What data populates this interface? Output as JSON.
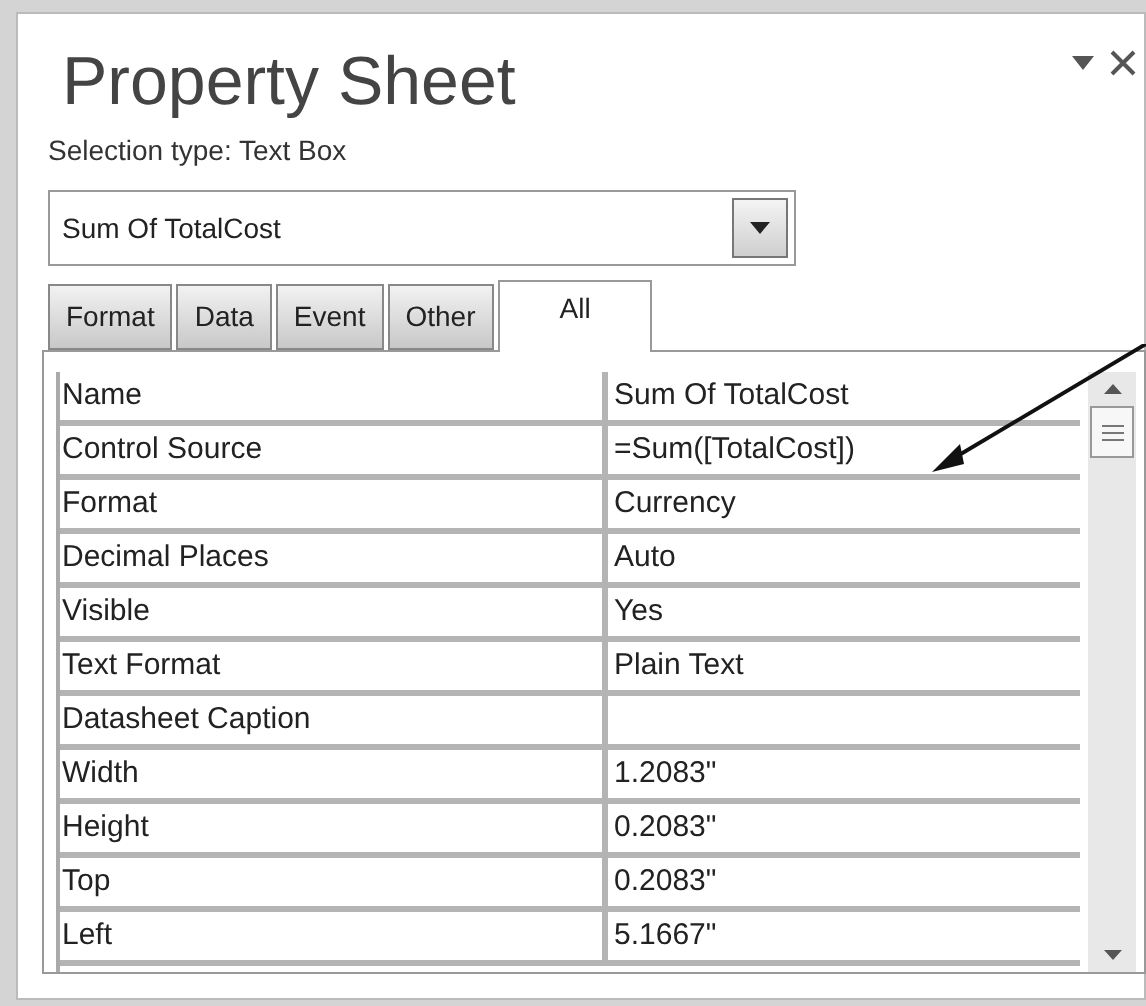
{
  "panel": {
    "title": "Property Sheet",
    "selection_type": "Selection type:  Text Box",
    "selector": {
      "value": "Sum Of TotalCost"
    }
  },
  "tabs": [
    {
      "label": "Format",
      "selected": false
    },
    {
      "label": "Data",
      "selected": false
    },
    {
      "label": "Event",
      "selected": false
    },
    {
      "label": "Other",
      "selected": false
    },
    {
      "label": "All",
      "selected": true
    }
  ],
  "properties": [
    {
      "name": "Name",
      "value": "Sum Of TotalCost"
    },
    {
      "name": "Control Source",
      "value": "=Sum([TotalCost])"
    },
    {
      "name": "Format",
      "value": "Currency"
    },
    {
      "name": "Decimal Places",
      "value": "Auto"
    },
    {
      "name": "Visible",
      "value": "Yes"
    },
    {
      "name": "Text Format",
      "value": "Plain Text"
    },
    {
      "name": "Datasheet Caption"
    },
    {
      "name": "Width",
      "value": "1.2083\""
    },
    {
      "name": "Height",
      "value": "0.2083\""
    },
    {
      "name": "Top",
      "value": "0.2083\""
    },
    {
      "name": "Left",
      "value": "5.1667\""
    }
  ]
}
